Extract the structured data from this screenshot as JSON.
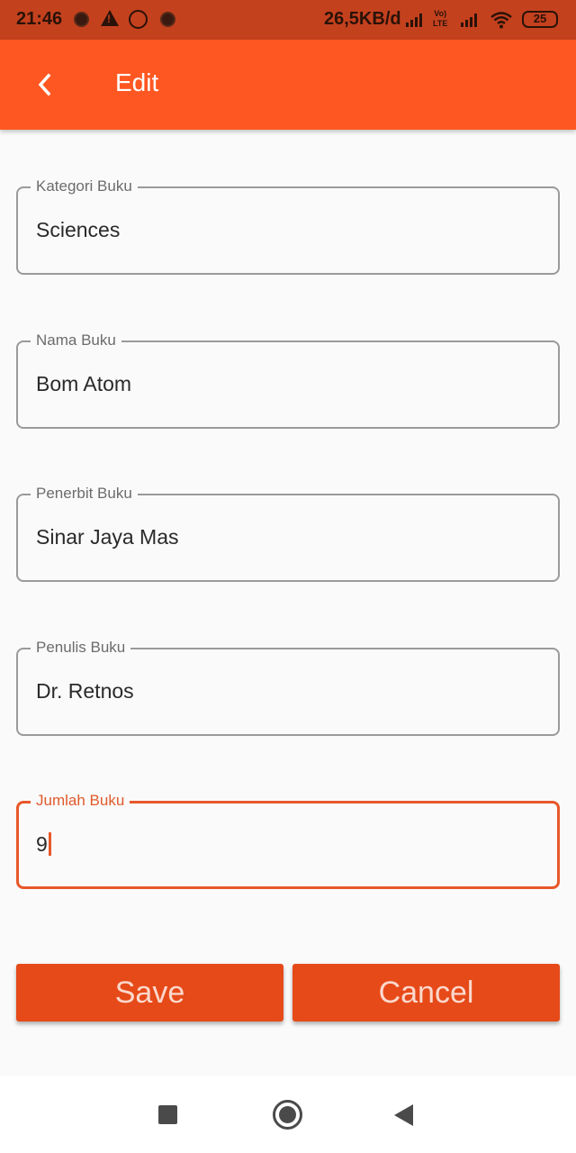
{
  "status_bar": {
    "time": "21:46",
    "network_speed": "26,5KB/d",
    "volte_line1": "Vo)",
    "volte_line2": "LTE",
    "battery": "25"
  },
  "app_bar": {
    "title": "Edit",
    "back_icon": "chevron-left-icon",
    "color": "#ff5722"
  },
  "form": {
    "fields": [
      {
        "label": "Kategori Buku",
        "value": "Sciences"
      },
      {
        "label": "Nama Buku",
        "value": "Bom Atom"
      },
      {
        "label": "Penerbit Buku",
        "value": "Sinar Jaya Mas"
      },
      {
        "label": "Penulis Buku",
        "value": "Dr. Retnos"
      },
      {
        "label": "Jumlah Buku",
        "value": "9",
        "focused": true
      }
    ],
    "accent_color": "#e8582a"
  },
  "buttons": {
    "save_label": "Save",
    "cancel_label": "Cancel",
    "color": "#e64a19"
  },
  "nav_bar": {
    "icons": [
      "recent-apps-icon",
      "home-icon",
      "back-icon"
    ]
  }
}
